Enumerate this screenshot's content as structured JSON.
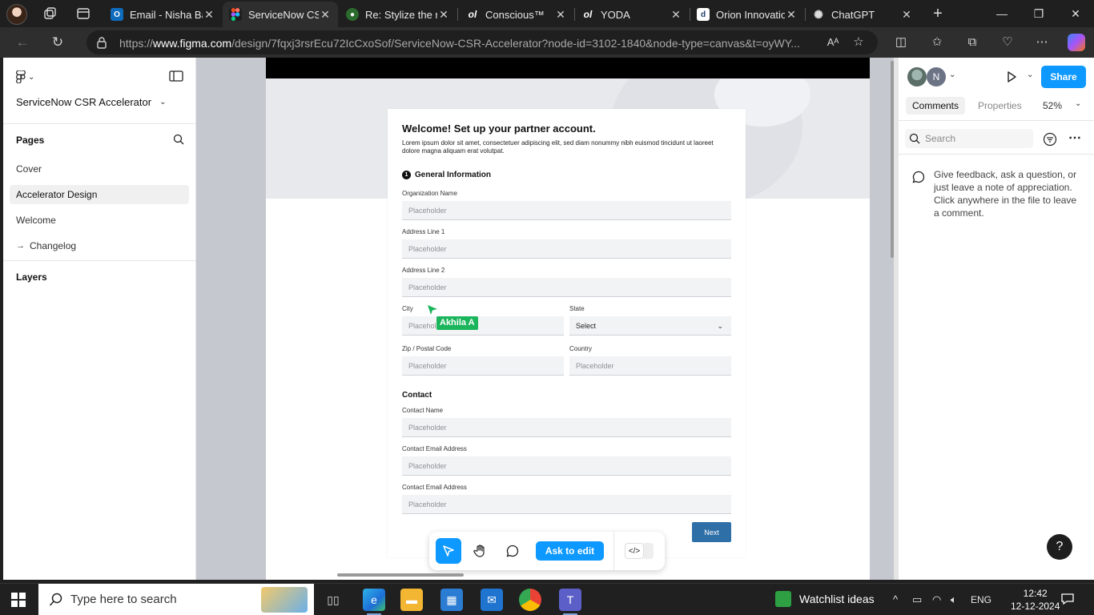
{
  "browser": {
    "tabs": [
      {
        "title": "Email - Nisha Ba",
        "favicon": "outlook-icon"
      },
      {
        "title": "ServiceNow CSR",
        "favicon": "figma-icon",
        "active": true
      },
      {
        "title": "Re: Stylize the re",
        "favicon": "globe-icon"
      },
      {
        "title": "Conscious™",
        "favicon": "ol-icon"
      },
      {
        "title": "YODA",
        "favicon": "ol-icon"
      },
      {
        "title": "Orion Innovatio",
        "favicon": "d-icon"
      },
      {
        "title": "ChatGPT",
        "favicon": "chatgpt-icon"
      }
    ],
    "url_prefix": "https://",
    "url_host": "www.figma.com",
    "url_path": "/design/7fqxj3rsrEcu72IcCxoSof/ServiceNow-CSR-Accelerator?node-id=3102-1840&node-type=canvas&t=oyWY..."
  },
  "figma": {
    "file_name": "ServiceNow CSR Accelerator",
    "pages_heading": "Pages",
    "pages": [
      "Cover",
      "Accelerator Design",
      "Welcome",
      "Changelog"
    ],
    "changelog_arrow": "→",
    "layers_heading": "Layers",
    "avatar_initial": "N",
    "share_label": "Share",
    "tab_comments": "Comments",
    "tab_properties": "Properties",
    "zoom": "52%",
    "search_placeholder": "Search",
    "comment_hint": "Give feedback, ask a question, or just leave a note of appreciation. Click anywhere in the file to leave a comment.",
    "help": "?",
    "ask_to_edit": "Ask to edit",
    "collaborator": "Akhila A"
  },
  "form": {
    "title": "Welcome!  Set up your partner account.",
    "intro": "Lorem ipsum dolor sit amet, consectetuer adipiscing elit, sed diam nonummy nibh euismod tincidunt ut laoreet dolore magna aliquam erat volutpat.",
    "step_number": "1",
    "section_general": "General Information",
    "org_label": "Organization Name",
    "addr1_label": "Address Line 1",
    "addr2_label": "Address Line 2",
    "city_label": "City",
    "state_label": "State",
    "state_value": "Select",
    "zip_label": "Zip / Postal Code",
    "country_label": "Country",
    "section_contact": "Contact",
    "contact_name_label": "Contact Name",
    "contact_email_label": "Contact Email Address",
    "contact_email2_label": "Contact Email Address",
    "placeholder": "Placeholder",
    "next_label": "Next"
  },
  "taskbar": {
    "search_placeholder": "Type here to search",
    "widget": "Watchlist ideas",
    "lang": "ENG",
    "time": "12:42",
    "date": "12-12-2024"
  },
  "colors": {
    "figma_blue": "#0d99ff",
    "next_button": "#2f6fa8",
    "collaborator": "#1bb55c"
  }
}
